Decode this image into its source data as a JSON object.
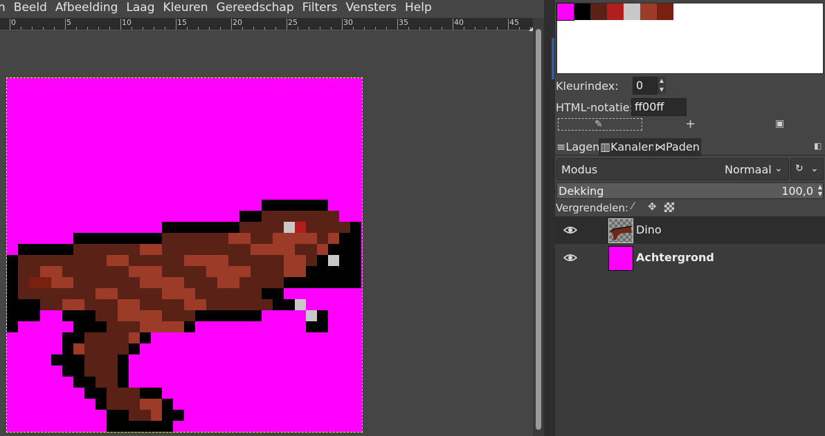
{
  "menubar": {
    "items": [
      "n",
      "Beeld",
      "Afbeelding",
      "Laag",
      "Kleuren",
      "Gereedschap",
      "Filters",
      "Vensters",
      "Help"
    ]
  },
  "ruler": {
    "labels": [
      "0",
      "5",
      "10",
      "15",
      "20",
      "25",
      "30",
      "35",
      "40",
      "45"
    ]
  },
  "image": {
    "background_color": "#ff00ff",
    "selection_outline_color": "#ffff00"
  },
  "palette": {
    "swatches": [
      "#ff00ff",
      "#000000",
      "#5a2216",
      "#b01e1e",
      "#c8c8c8",
      "#9c3c28",
      "#7a2010"
    ],
    "selected_index": 0
  },
  "color_index": {
    "label": "Kleurindex:",
    "value": "0"
  },
  "html_notation": {
    "label": "HTML-notatie:",
    "value": "ff00ff"
  },
  "palette_toolbar": {
    "icons": [
      "edit-icon",
      "add-icon",
      "palette-menu-icon"
    ]
  },
  "tabs": [
    {
      "label": "Lagen",
      "icon": "layers-icon",
      "active": true
    },
    {
      "label": "Kanalen",
      "icon": "channels-icon",
      "active": false
    },
    {
      "label": "Paden",
      "icon": "paths-icon",
      "active": false
    }
  ],
  "layer_mode": {
    "label": "Modus",
    "value": "Normaal"
  },
  "opacity": {
    "label": "Dekking",
    "value": "100,0"
  },
  "lock": {
    "label": "Vergrendelen:"
  },
  "layers": [
    {
      "name": "Dino",
      "visible": true,
      "selected": true,
      "thumb": "dino-thumbnail"
    },
    {
      "name": "Achtergrond",
      "visible": true,
      "selected": false,
      "thumb": "magenta-fill",
      "bold": true
    }
  ],
  "colors": {
    "accent": "#3a5a9a",
    "panel_bg": "#454545",
    "dark_bg": "#2e2e2e"
  }
}
